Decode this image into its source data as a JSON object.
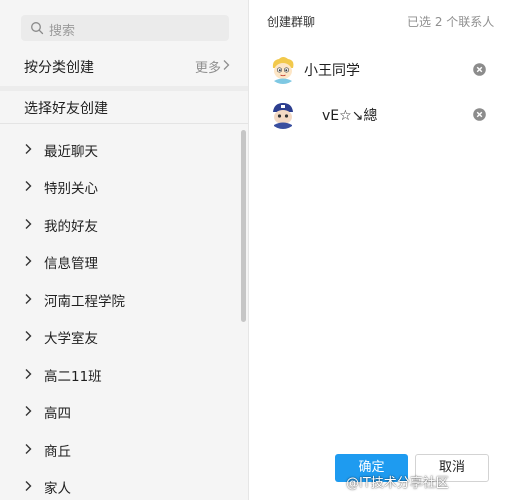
{
  "search": {
    "placeholder": "搜索"
  },
  "left": {
    "category_create_label": "按分类创建",
    "more_label": "更多",
    "friend_create_label": "选择好友创建",
    "groups": [
      "最近聊天",
      "特别关心",
      "我的好友",
      "信息管理",
      "河南工程学院",
      "大学室友",
      "高二11班",
      "高四",
      "商丘",
      "家人"
    ]
  },
  "right": {
    "title": "创建群聊",
    "selected_count": "已选 2 个联系人",
    "selected": [
      {
        "name": "小王同学"
      },
      {
        "name": "vE☆↘總"
      }
    ]
  },
  "buttons": {
    "ok": "确定",
    "cancel": "取消"
  },
  "watermark": "@IT技术分享社区",
  "colors": {
    "accent": "#1e9bf0"
  }
}
